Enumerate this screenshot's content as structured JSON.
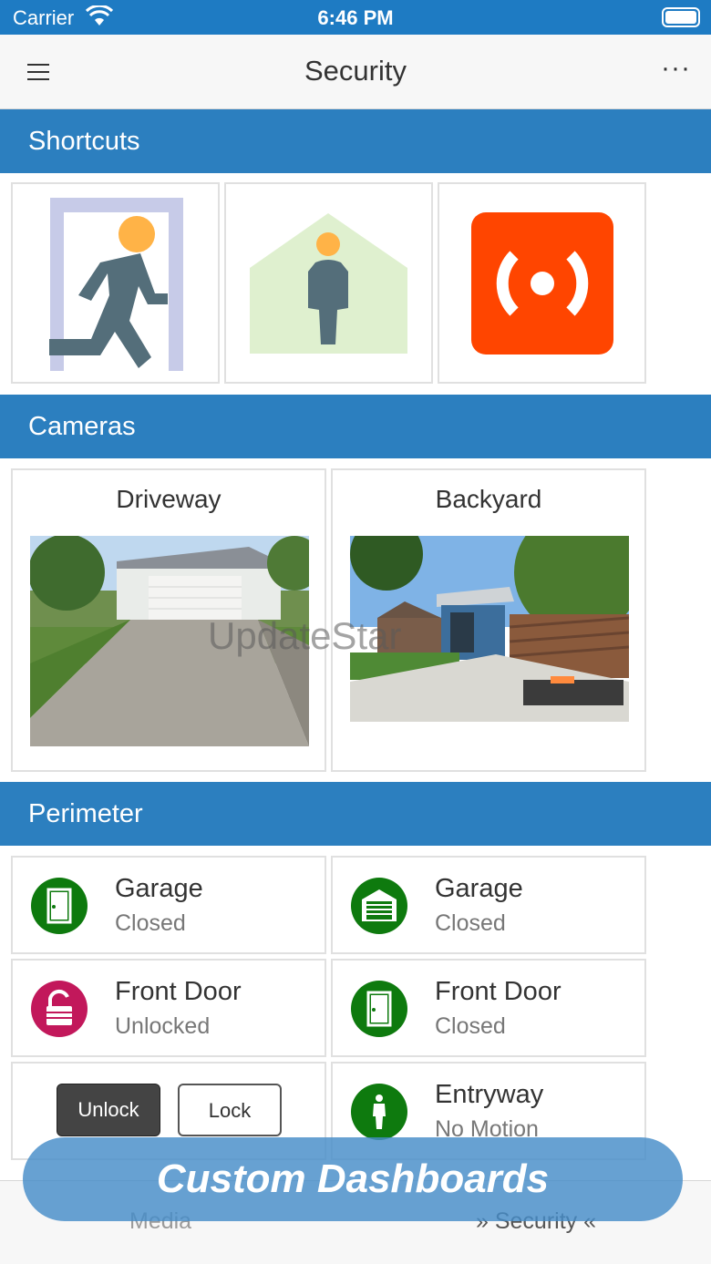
{
  "status_bar": {
    "carrier": "Carrier",
    "time": "6:46 PM"
  },
  "nav": {
    "title": "Security",
    "more": "···"
  },
  "sections": {
    "shortcuts": "Shortcuts",
    "cameras": "Cameras",
    "perimeter": "Perimeter"
  },
  "shortcuts": [
    {
      "icon": "running-person-exit-icon"
    },
    {
      "icon": "home-presence-icon"
    },
    {
      "icon": "alarm-siren-icon"
    }
  ],
  "cameras": [
    {
      "name": "Driveway"
    },
    {
      "name": "Backyard"
    }
  ],
  "watermark": "UpdateStar",
  "perimeter": {
    "garage_door": {
      "name": "Garage",
      "state": "Closed"
    },
    "garage_overhead": {
      "name": "Garage",
      "state": "Closed"
    },
    "front_door_lock": {
      "name": "Front Door",
      "state": "Unlocked"
    },
    "front_door_contact": {
      "name": "Front Door",
      "state": "Closed"
    },
    "unlock_label": "Unlock",
    "lock_label": "Lock",
    "entryway": {
      "name": "Entryway",
      "state": "No Motion"
    }
  },
  "colors": {
    "header": "#2c7fbf",
    "status_ok": "#0e7a0e",
    "status_alert": "#c2185b",
    "siren": "#ff4500"
  },
  "tabs": {
    "media": "Media",
    "security": "»  Security  «"
  },
  "banner": "Custom Dashboards"
}
